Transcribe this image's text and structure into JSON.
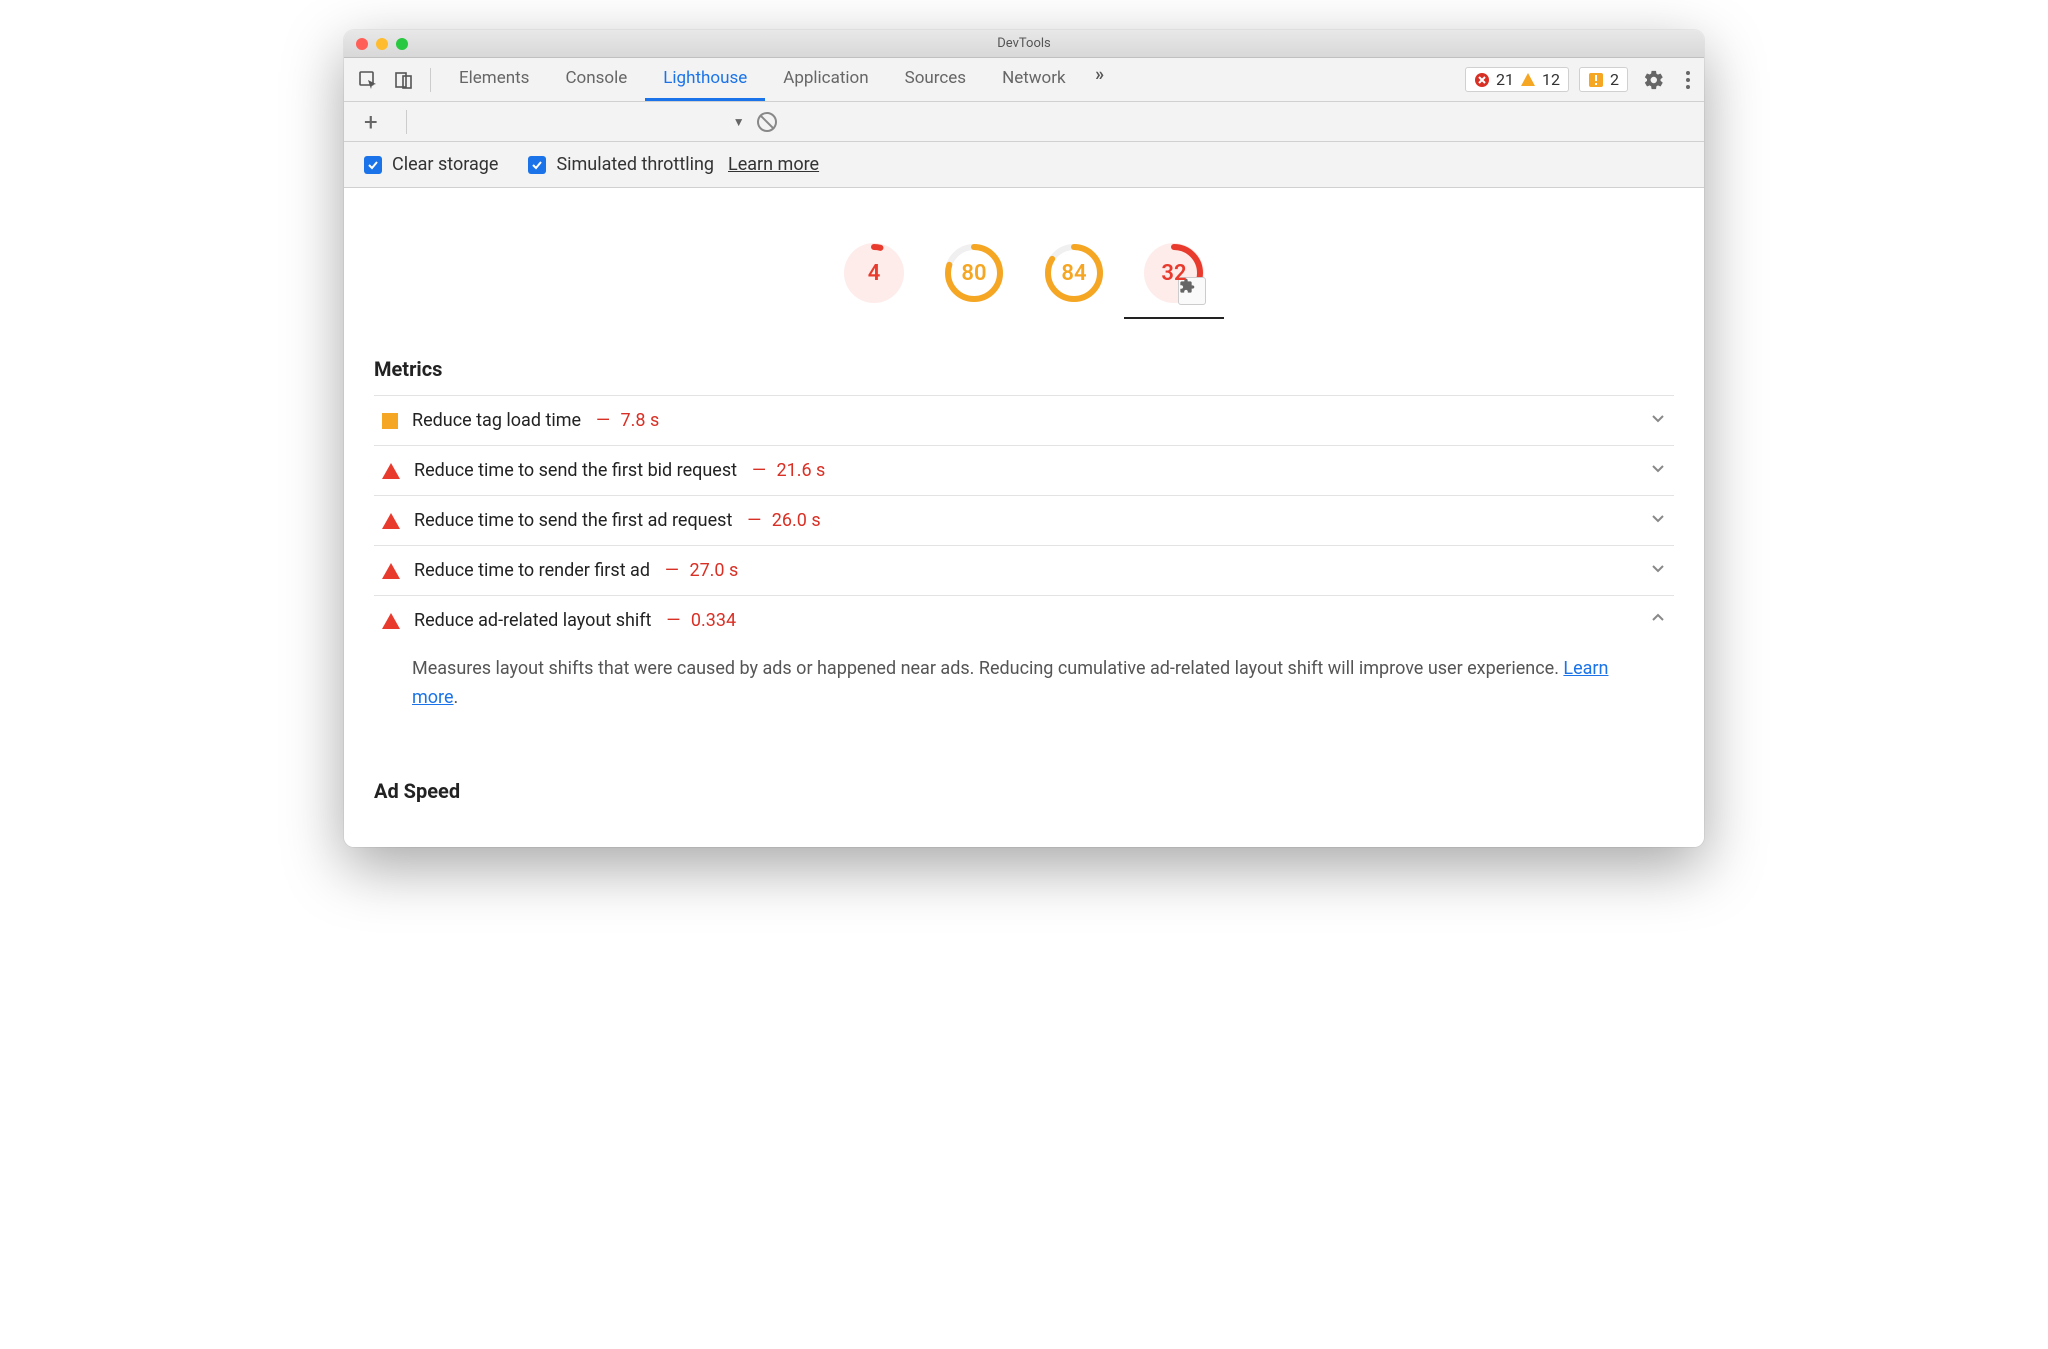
{
  "window": {
    "title": "DevTools"
  },
  "tabbar": {
    "tabs": [
      "Elements",
      "Console",
      "Lighthouse",
      "Application",
      "Sources",
      "Network"
    ],
    "active_index": 2,
    "errors": "21",
    "warnings": "12",
    "issues": "2"
  },
  "options": {
    "clear_storage": "Clear storage",
    "simulated_throttling": "Simulated throttling",
    "learn_more": "Learn more"
  },
  "gauges": [
    {
      "score": 4,
      "color": "#e83b2e",
      "bg": "#fdecea"
    },
    {
      "score": 80,
      "color": "#f5a623",
      "bg": "#ffffff"
    },
    {
      "score": 84,
      "color": "#f5a623",
      "bg": "#ffffff"
    },
    {
      "score": 32,
      "color": "#e83b2e",
      "bg": "#fdecea",
      "selected": true,
      "ext": true
    }
  ],
  "sections": {
    "metrics_title": "Metrics",
    "adspeed_title": "Ad Speed"
  },
  "audits": [
    {
      "sev": "sq",
      "title": "Reduce tag load time",
      "value": "7.8 s",
      "open": false
    },
    {
      "sev": "tri",
      "title": "Reduce time to send the first bid request",
      "value": "21.6 s",
      "open": false
    },
    {
      "sev": "tri",
      "title": "Reduce time to send the first ad request",
      "value": "26.0 s",
      "open": false
    },
    {
      "sev": "tri",
      "title": "Reduce time to render first ad",
      "value": "27.0 s",
      "open": false
    },
    {
      "sev": "tri",
      "title": "Reduce ad-related layout shift",
      "value": "0.334",
      "open": true,
      "desc": "Measures layout shifts that were caused by ads or happened near ads. Reducing cumulative ad-related layout shift will improve user experience. ",
      "link": "Learn more",
      "suffix": "."
    }
  ]
}
